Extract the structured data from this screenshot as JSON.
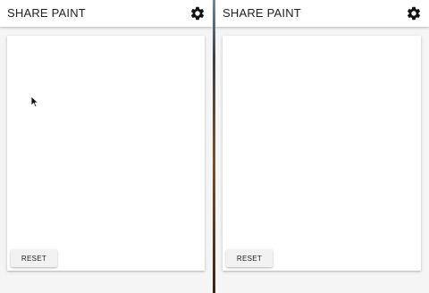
{
  "left_window": {
    "title": "SHARE PAINT",
    "settings_icon": "gear-icon",
    "reset_label": "RESET"
  },
  "right_window": {
    "title": "SHARE PAINT",
    "settings_icon": "gear-icon",
    "reset_label": "RESET"
  },
  "colors": {
    "appbar": "#ffffff",
    "background": "#f5f5f5",
    "card": "#ffffff",
    "text": "#212121",
    "button": "#f2f2f2"
  },
  "pointer_icon": "mouse-pointer-icon"
}
